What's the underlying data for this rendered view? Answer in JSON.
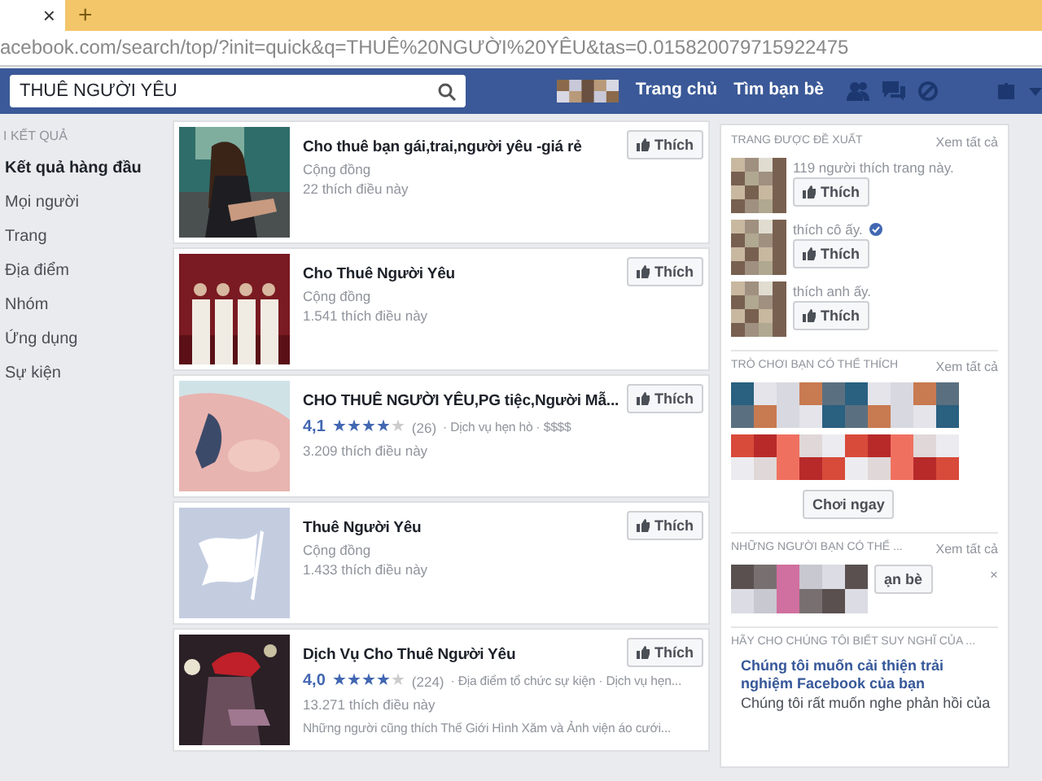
{
  "browser": {
    "tab_close": "×",
    "new_tab": "+",
    "address": "acebook.com/search/top/?init=quick&q=THUÊ%20NGƯỜI%20YÊU&tas=0.015820079715922475"
  },
  "header": {
    "search_value": "THUÊ NGƯỜI YÊU",
    "nav": [
      "Trang chủ",
      "Tìm bạn bè"
    ]
  },
  "sidebar": {
    "heading": "I KẾT QUẢ",
    "items": [
      {
        "label": "Kết quả hàng đầu",
        "selected": true
      },
      {
        "label": "Mọi người",
        "selected": false
      },
      {
        "label": "Trang",
        "selected": false
      },
      {
        "label": "Địa điểm",
        "selected": false
      },
      {
        "label": "Nhóm",
        "selected": false
      },
      {
        "label": "Ứng dụng",
        "selected": false
      },
      {
        "label": "Sự kiện",
        "selected": false
      }
    ]
  },
  "results": [
    {
      "title": "Cho thuê bạn gái,trai,người yêu -giá rẻ",
      "category": "Cộng đồng",
      "likes": "22 thích điều này",
      "button": "Thích"
    },
    {
      "title": "Cho Thuê Người Yêu",
      "category": "Cộng đồng",
      "likes": "1.541 thích điều này",
      "button": "Thích"
    },
    {
      "title": "CHO THUÊ NGƯỜI YÊU,PG tiệc,Người Mẫ...",
      "rating": "4,1",
      "stars": 4,
      "reviews": "(26)",
      "category": "· Dịch vụ hẹn hò · $$$$",
      "likes": "3.209 thích điều này",
      "button": "Thích"
    },
    {
      "title": "Thuê Người Yêu",
      "category": "Cộng đồng",
      "likes": "1.433 thích điều này",
      "button": "Thích"
    },
    {
      "title": "Dịch Vụ Cho Thuê Người Yêu",
      "rating": "4,0",
      "stars": 4,
      "reviews": "(224)",
      "category": "· Địa điểm tổ chức sự kiện · Dịch vụ hẹn...",
      "likes": "13.271 thích điều này",
      "extra": "Những người cũng thích Thế Giới Hình Xăm và Ảnh viện áo cưới...",
      "button": "Thích"
    }
  ],
  "right": [
    {
      "heading": "TRANG ĐƯỢC ĐỀ XUẤT",
      "see_all": "Xem tất cả",
      "items": [
        {
          "kind": "page",
          "text": "119 người thích trang này.",
          "button": "Thích",
          "verified": false
        },
        {
          "kind": "page",
          "text": "thích cô ấy.",
          "button": "Thích",
          "verified": true
        },
        {
          "kind": "page",
          "text": "thích anh ấy.",
          "button": "Thích",
          "verified": false
        }
      ]
    },
    {
      "heading": "TRÒ CHƠI BẠN CÓ THỂ THÍCH",
      "see_all": "Xem tất cả",
      "items": [
        {
          "kind": "game"
        },
        {
          "kind": "game",
          "button": "Chơi ngay"
        }
      ]
    },
    {
      "heading": "NHỮNG NGƯỜI BẠN CÓ THỂ ...",
      "see_all": "Xem tất cả",
      "items": [
        {
          "kind": "person",
          "button": "ạn bè",
          "close": "×"
        }
      ]
    },
    {
      "heading": "HÃY CHO CHÚNG TÔI BIẾT SUY NGHĨ CỦA ...",
      "items": [
        {
          "kind": "feedback",
          "link": "Chúng tôi muốn cải thiện trải nghiệm Facebook của bạn",
          "text": "Chúng tôi rất muốn nghe phản hồi của"
        }
      ]
    }
  ]
}
